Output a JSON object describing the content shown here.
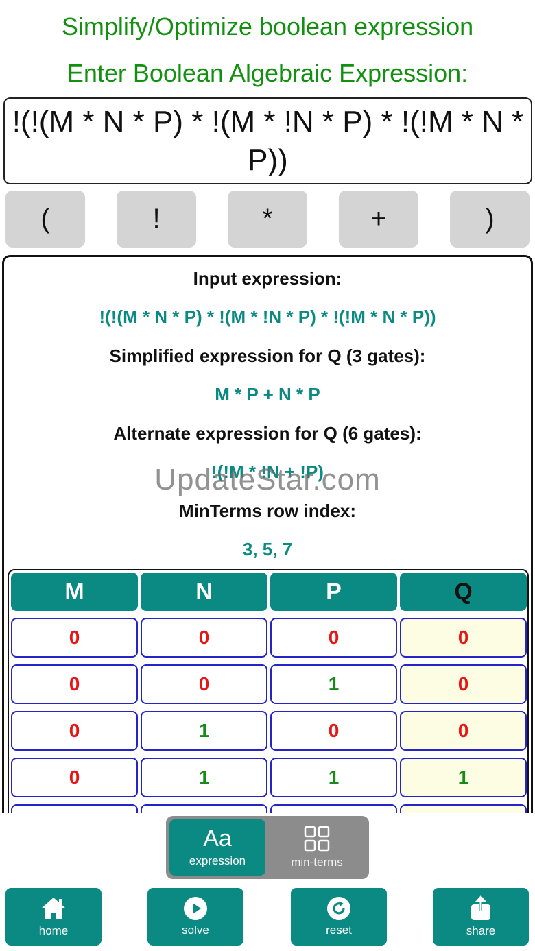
{
  "header": {
    "title": "Simplify/Optimize boolean expression",
    "subtitle": "Enter Boolean Algebraic Expression:"
  },
  "input": {
    "value": "!(!(M * N * P) * !(M * !N * P) * !(!M * N * P))"
  },
  "keys": [
    "(",
    "!",
    "*",
    "+",
    ")"
  ],
  "result": {
    "input_heading": "Input expression:",
    "input_expr": "!(!(M * N * P) * !(M * !N * P) * !(!M * N * P))",
    "simplified_heading": "Simplified expression for Q (3 gates):",
    "simplified_expr": "M * P + N * P",
    "alternate_heading": "Alternate expression for Q (6 gates):",
    "alternate_expr": "!(!M * !N + !P)",
    "minterms_heading": "MinTerms row index:",
    "minterms": "3, 5, 7"
  },
  "watermark": "UpdateStar.com",
  "truth_table": {
    "headers": [
      "M",
      "N",
      "P",
      "Q"
    ],
    "rows": [
      [
        "0",
        "0",
        "0",
        "0"
      ],
      [
        "0",
        "0",
        "1",
        "0"
      ],
      [
        "0",
        "1",
        "0",
        "0"
      ],
      [
        "0",
        "1",
        "1",
        "1"
      ]
    ]
  },
  "mode_toggle": {
    "expression": {
      "icon": "Aa",
      "label": "expression"
    },
    "minterms": {
      "label": "min-terms"
    }
  },
  "toolbar": {
    "home": "home",
    "solve": "solve",
    "reset": "reset",
    "share": "share"
  },
  "colors": {
    "title_green": "#11910f",
    "teal": "#0a8a82",
    "zero_red": "#e81515",
    "one_green": "#178a17",
    "q_cell_bg": "#fdfde3"
  }
}
